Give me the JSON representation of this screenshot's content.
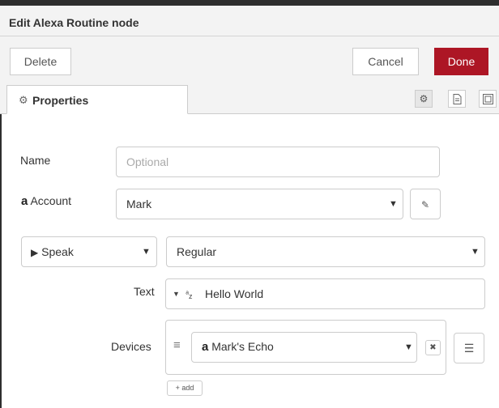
{
  "dialog": {
    "title": "Edit Alexa Routine node",
    "delete_label": "Delete",
    "cancel_label": "Cancel",
    "done_label": "Done"
  },
  "tabs": {
    "properties_label": "Properties",
    "properties_icon": "gear-icon"
  },
  "form": {
    "name_label": "Name",
    "name_placeholder": "Optional",
    "name_value": "",
    "account_label": "Account",
    "account_value": "Mark",
    "action_value": "Speak",
    "mode_value": "Regular",
    "text_label": "Text",
    "text_type_icon": "az",
    "text_value": "Hello World",
    "devices_label": "Devices",
    "device_value": "Mark's Echo",
    "add_label": "add"
  },
  "colors": {
    "primary": "#ad1625",
    "header_bg": "#f3f3f3",
    "border": "#cccccc"
  }
}
